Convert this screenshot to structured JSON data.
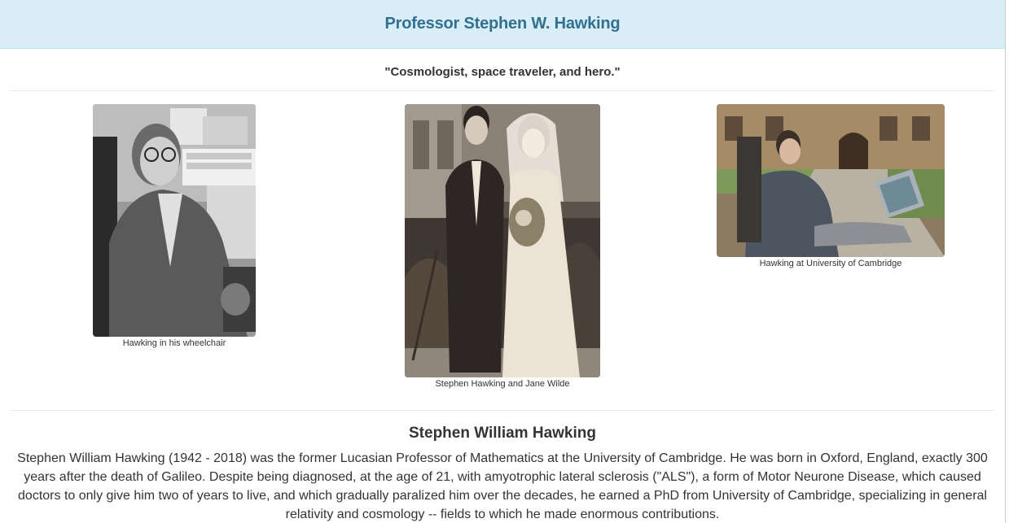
{
  "header": {
    "title": "Professor Stephen W. Hawking"
  },
  "quote": "\"Cosmologist, space traveler, and hero.\"",
  "gallery": [
    {
      "caption": "Hawking in his wheelchair",
      "photo_tone": "black-and-white"
    },
    {
      "caption": "Stephen Hawking and Jane Wilde",
      "photo_tone": "sepia"
    },
    {
      "caption": "Hawking at University of Cambridge",
      "photo_tone": "color"
    }
  ],
  "bio": {
    "heading": "Stephen William Hawking",
    "text": "Stephen William Hawking (1942 - 2018) was the former Lucasian Professor of Mathematics at the University of Cambridge. He was born in Oxford, England, exactly 300 years after the death of Galileo. Despite being diagnosed, at the age of 21, with amyotrophic lateral sclerosis (\"ALS\"), a form of Motor Neurone Disease, which caused doctors to only give him two of years to live, and which gradually paralized him over the decades, he earned a PhD from University of Cambridge, specializing in general relativity and cosmology -- fields to which he made enormous contributions."
  },
  "colors": {
    "header_bg": "#d9edf7",
    "header_text": "#31708f",
    "body_text": "#333333"
  }
}
